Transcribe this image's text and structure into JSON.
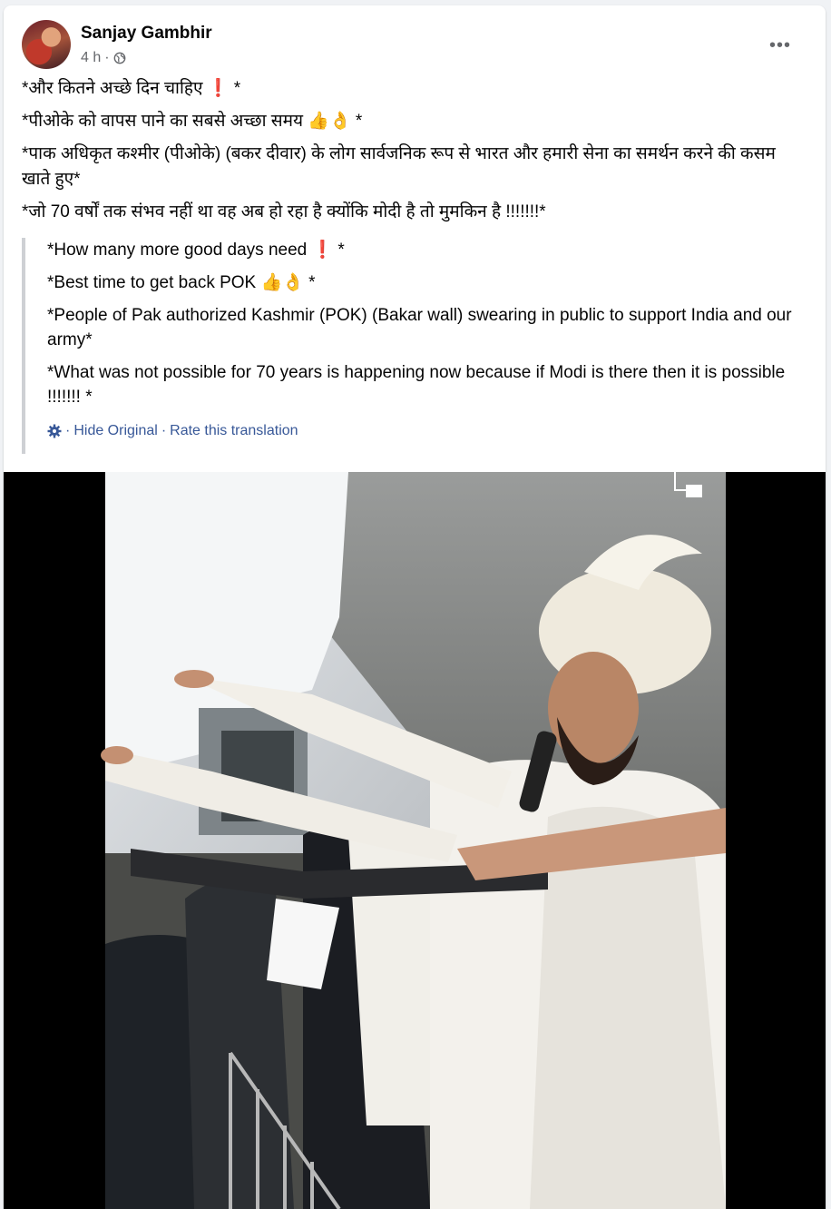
{
  "post": {
    "author": "Sanjay Gambhir",
    "time": "4 h",
    "meta_separator": "·",
    "more_label": "•••"
  },
  "original_lines": [
    "*और कितने अच्छे दिन चाहिए ❗ *",
    "*पीओके को वापस पाने का सबसे अच्छा समय 👍👌 *",
    "*पाक अधिकृत कश्मीर (पीओके) (बकर दीवार) के लोग सार्वजनिक रूप से भारत और हमारी सेना का समर्थन करने की कसम खाते हुए*",
    "*जो 70 वर्षों तक संभव नहीं था वह अब हो रहा है क्योंकि मोदी है तो मुमकिन है !!!!!!!*"
  ],
  "translation_lines": [
    "*How many more good days need ❗ *",
    "*Best time to get back POK 👍👌 *",
    "*People of Pak authorized Kashmir (POK) (Bakar wall) swearing in public to support India and our army*",
    "*What was not possible for 70 years is happening now because if Modi is there then it is possible !!!!!!! *"
  ],
  "translation_actions": {
    "separator": "·",
    "hide_original": "Hide Original",
    "rate": "Rate this translation"
  },
  "colors": {
    "link": "#385898",
    "muted": "#65676b",
    "quote_bar": "#ced0d4"
  },
  "icons": {
    "globe": "globe-icon",
    "gear": "gear-icon",
    "more": "more-icon"
  }
}
